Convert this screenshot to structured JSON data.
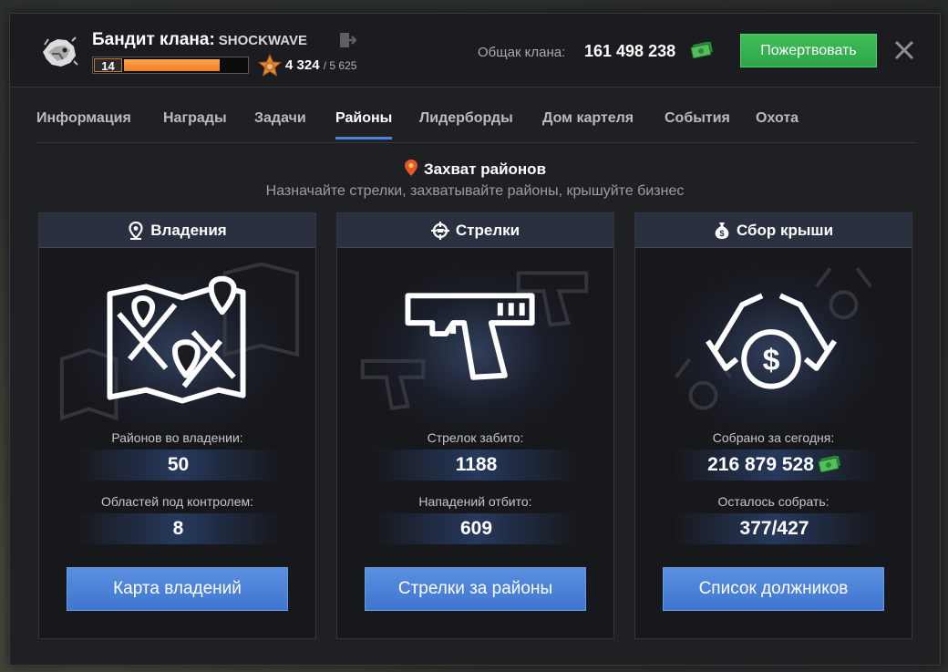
{
  "header": {
    "title": "Бандит клана:",
    "clan_name": "SHOCKWAVE",
    "level": "14",
    "level_progress": 0.78,
    "rank_points": "4 324",
    "rank_points_max": "/ 5 625",
    "bank_label": "Общак клана:",
    "bank_value": "161 498 238",
    "donate_label": "Пожертвовать"
  },
  "tabs": [
    {
      "label": "Информация",
      "active": false
    },
    {
      "label": "Награды",
      "active": false
    },
    {
      "label": "Задачи",
      "active": false
    },
    {
      "label": "Районы",
      "active": true
    },
    {
      "label": "Лидерборды",
      "active": false
    },
    {
      "label": "Дом картеля",
      "active": false
    },
    {
      "label": "События",
      "active": false
    },
    {
      "label": "Охота",
      "active": false
    }
  ],
  "section": {
    "title": "Захват районов",
    "subtitle": "Назначайте стрелки, захватывайте районы, крышуйте бизнес"
  },
  "cards": [
    {
      "title": "Владения",
      "icon": "map-pin-icon",
      "art": "map-icon",
      "stat1_label": "Районов во владении:",
      "stat1_value": "50",
      "stat2_label": "Областей под контролем:",
      "stat2_value": "8",
      "button": "Карта владений"
    },
    {
      "title": "Стрелки",
      "icon": "crosshair-icon",
      "art": "pistol-icon",
      "stat1_label": "Стрелок забито:",
      "stat1_value": "1188",
      "stat2_label": "Нападений отбито:",
      "stat2_value": "609",
      "button": "Стрелки за районы"
    },
    {
      "title": "Сбор крыши",
      "icon": "money-bag-icon",
      "art": "protected-money-icon",
      "stat1_label": "Собрано за сегодня:",
      "stat1_value": "216 879 528",
      "stat2_label": "Осталось собрать:",
      "stat2_value": "377/427",
      "button": "Список должников"
    }
  ],
  "colors": {
    "accent_blue": "#4a86d8",
    "donate_green": "#35b04f",
    "level_orange": "#f29237"
  }
}
